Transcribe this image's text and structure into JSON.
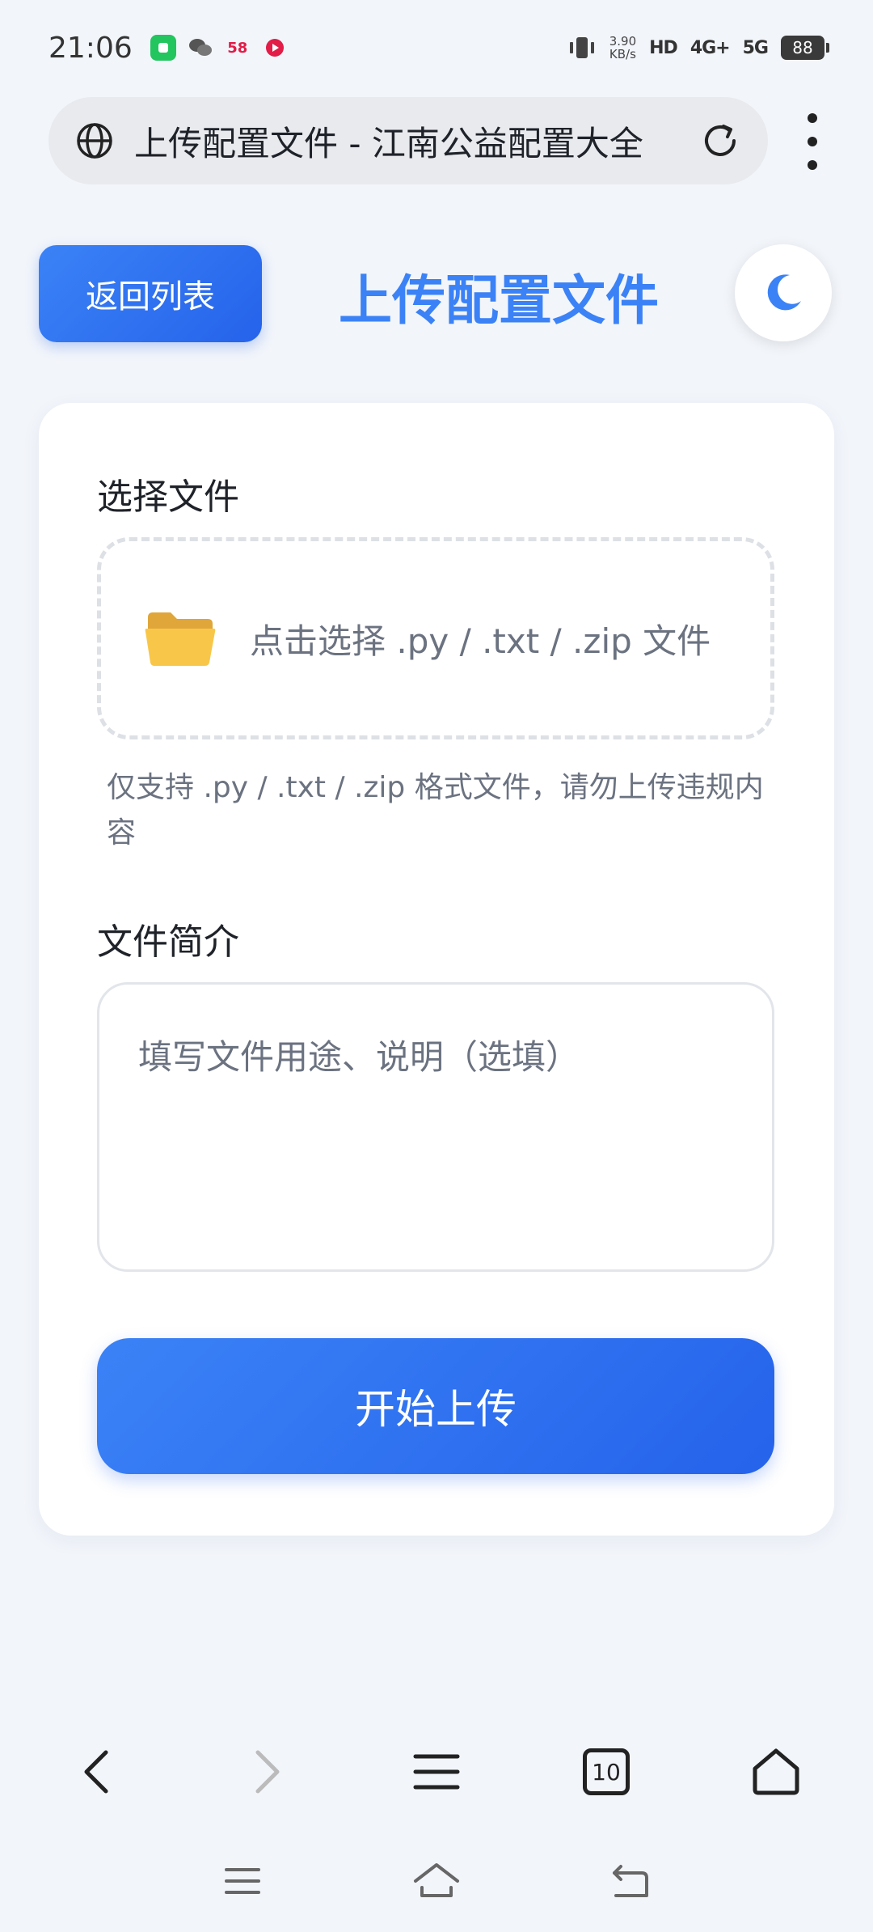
{
  "status": {
    "time": "21:06",
    "net_speed_value": "3.90",
    "net_speed_unit": "KB/s",
    "hd": "HD",
    "net1": "4G+",
    "net2": "5G",
    "battery": "88",
    "app_badge": "58"
  },
  "browser": {
    "url_title": "上传配置文件 - 江南公益配置大全",
    "tab_count": "10"
  },
  "header": {
    "back_label": "返回列表",
    "title": "上传配置文件"
  },
  "form": {
    "file_label": "选择文件",
    "drop_text": "点击选择 .py / .txt / .zip 文件",
    "hint": "仅支持 .py / .txt / .zip 格式文件，请勿上传违规内容",
    "desc_label": "文件简介",
    "desc_placeholder": "填写文件用途、说明（选填）",
    "submit_label": "开始上传"
  },
  "colors": {
    "accent": "#3b82f6",
    "accent_dark": "#2563eb",
    "background": "#f2f5fa"
  }
}
